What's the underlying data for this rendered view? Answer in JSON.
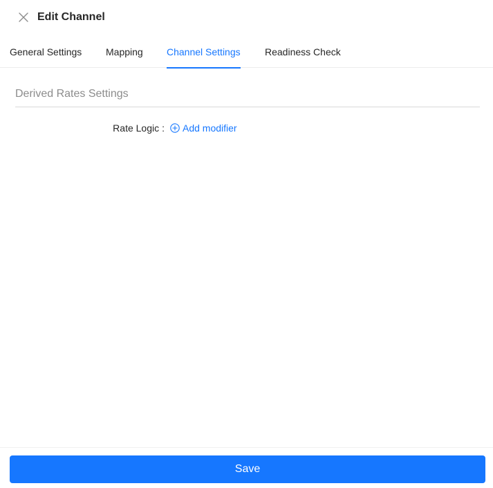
{
  "header": {
    "title": "Edit Channel",
    "close_icon": "close-icon"
  },
  "tabs": [
    {
      "label": "General Settings",
      "active": false
    },
    {
      "label": "Mapping",
      "active": false
    },
    {
      "label": "Channel Settings",
      "active": true
    },
    {
      "label": "Readiness Check",
      "active": false
    }
  ],
  "section": {
    "title": "Derived Rates Settings"
  },
  "form": {
    "rate_logic_label": "Rate Logic",
    "colon": ":",
    "add_modifier_label": "Add modifier",
    "add_icon": "plus-circle-icon"
  },
  "footer": {
    "save_label": "Save"
  },
  "colors": {
    "accent": "#1677ff",
    "text": "#262626",
    "muted": "#8c8c8c"
  }
}
